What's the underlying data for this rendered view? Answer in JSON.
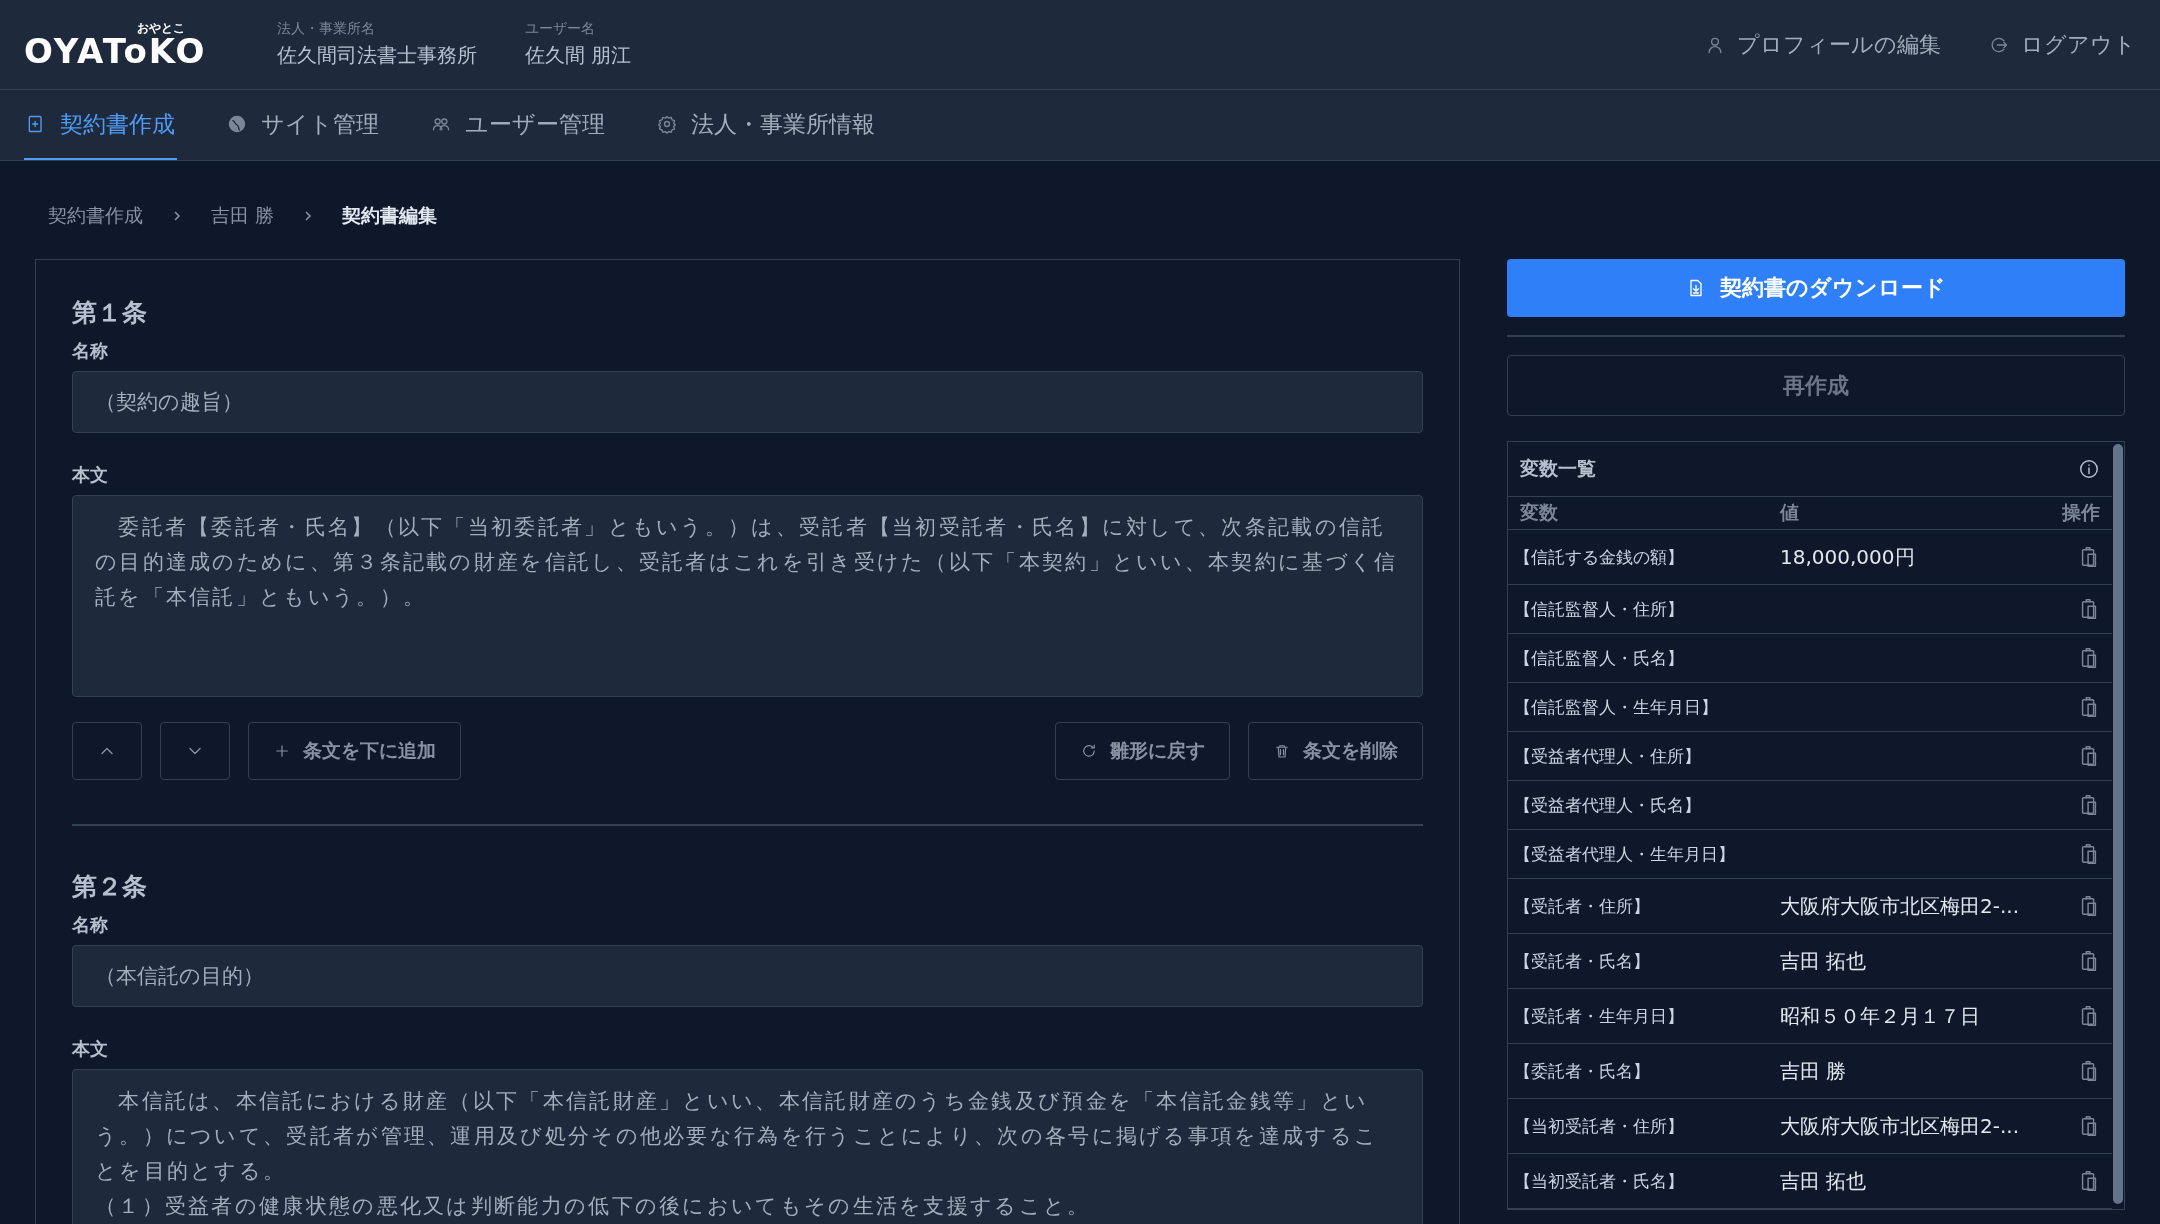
{
  "header": {
    "logo": "OYAToKO",
    "logo_ruby": "おやとこ",
    "fields": [
      {
        "label": "法人・事業所名",
        "value": "佐久間司法書士事務所"
      },
      {
        "label": "ユーザー名",
        "value": "佐久間 朋江"
      }
    ],
    "links": [
      {
        "kind": "profile",
        "label": "プロフィールの編集"
      },
      {
        "kind": "logout",
        "label": "ログアウト"
      }
    ]
  },
  "nav": {
    "tabs": [
      {
        "kind": "document",
        "label": "契約書作成",
        "selected": true
      },
      {
        "kind": "globe",
        "label": "サイト管理",
        "selected": false
      },
      {
        "kind": "users",
        "label": "ユーザー管理",
        "selected": false
      },
      {
        "kind": "gear",
        "label": "法人・事業所情報",
        "selected": false
      }
    ]
  },
  "breadcrumb": [
    {
      "label": "契約書作成",
      "current": false
    },
    {
      "label": "吉田 勝",
      "current": false
    },
    {
      "label": "契約書編集",
      "current": true
    }
  ],
  "articles": [
    {
      "heading": "第１条",
      "name_label": "名称",
      "name": "（契約の趣旨）",
      "body_label": "本文",
      "body": [
        "　委託者【委託者・氏名】（以下「当初委託者」ともいう。）は、受託者【当初受託者・氏名】に対して、次条記載の信託の目的達成のために、第３条記載の財産を信託し、受託者はこれを引き受けた（以下「本契約」といい、本契約に基づく信託を「本信託」ともいう。）。"
      ],
      "buttons": [
        {
          "kind": "up"
        },
        {
          "kind": "down"
        },
        {
          "kind": "add",
          "label": "条文を下に追加"
        },
        {
          "kind": "reset",
          "label": "雛形に戻す"
        },
        {
          "kind": "delete",
          "label": "条文を削除"
        }
      ]
    },
    {
      "heading": "第２条",
      "name_label": "名称",
      "name": "（本信託の目的）",
      "body_label": "本文",
      "body": [
        "　本信託は、本信託における財産（以下「本信託財産」といい、本信託財産のうち金銭及び預金を「本信託金銭等」という。）について、受託者が管理、運用及び処分その他必要な行為を行うことにより、次の各号に掲げる事項を達成することを目的とする。",
        "（１）受益者の健康状態の悪化又は判断能力の低下の後においてもその生活を支援すること。"
      ]
    }
  ],
  "sidebar": {
    "download_button": "契約書のダウンロード",
    "regenerate_button": "再作成",
    "variables": {
      "title": "変数一覧",
      "columns": [
        "変数",
        "値",
        "操作"
      ],
      "rows": [
        {
          "variable": "【信託する金銭の額】",
          "value": "18,000,000円"
        },
        {
          "variable": "【信託監督人・住所】"
        },
        {
          "variable": "【信託監督人・氏名】"
        },
        {
          "variable": "【信託監督人・生年月日】"
        },
        {
          "variable": "【受益者代理人・住所】"
        },
        {
          "variable": "【受益者代理人・氏名】"
        },
        {
          "variable": "【受益者代理人・生年月日】"
        },
        {
          "variable": "【受託者・住所】",
          "value": "大阪府大阪市北区梅田2-..."
        },
        {
          "variable": "【受託者・氏名】",
          "value": "吉田 拓也"
        },
        {
          "variable": "【受託者・生年月日】",
          "value": "昭和５０年２月１７日"
        },
        {
          "variable": "【委託者・氏名】",
          "value": "吉田 勝"
        },
        {
          "variable": "【当初受託者・住所】",
          "value": "大阪府大阪市北区梅田2-..."
        },
        {
          "variable": "【当初受託者・氏名】",
          "value": "吉田 拓也"
        }
      ]
    }
  }
}
